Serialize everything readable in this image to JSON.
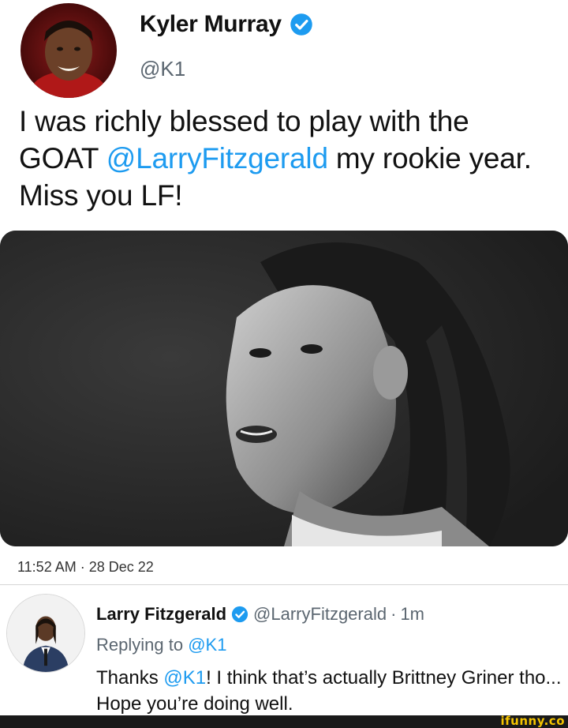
{
  "main_tweet": {
    "author_name": "Kyler Murray",
    "author_handle": "@K1",
    "text_1": "I was richly blessed to play with the GOAT ",
    "mention": "@LarryFitzgerald",
    "text_2": " my rookie year. Miss you LF!",
    "timestamp": "11:52 AM · 28 Dec 22"
  },
  "reply": {
    "author_name": "Larry Fitzgerald",
    "author_handle": "@LarryFitzgerald",
    "separator": "·",
    "time": "1m",
    "replying_prefix": "Replying to ",
    "replying_handle": "@K1",
    "text_1": "Thanks ",
    "mention": "@K1",
    "text_2": "! I think that’s actually Brittney Griner tho... Hope you’re doing well."
  },
  "watermark": "ifunny.co",
  "colors": {
    "mention": "#1d9bf0",
    "verified": "#1d9bf0",
    "muted": "#5b6670"
  },
  "icons": {
    "verified": "verified-badge-icon"
  }
}
